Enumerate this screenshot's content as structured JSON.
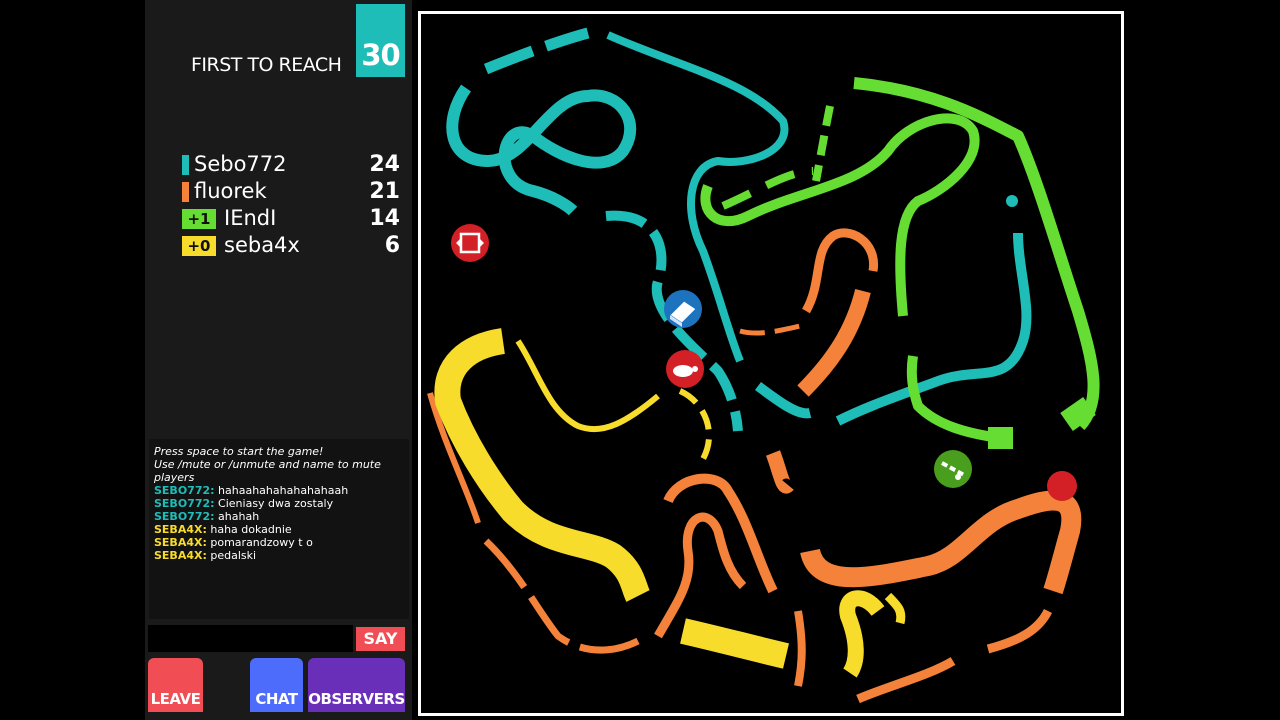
{
  "goal": {
    "label": "FIRST TO REACH",
    "value": "30"
  },
  "scoreboard": [
    {
      "name": "Sebo772",
      "score": "24",
      "color": "#1fbdb8",
      "badge": ""
    },
    {
      "name": "fluorek",
      "score": "21",
      "color": "#f5823a",
      "badge": ""
    },
    {
      "name": "IEndI",
      "score": "14",
      "color": "#66dd33",
      "badge": "+1"
    },
    {
      "name": "seba4x",
      "score": "6",
      "color": "#f8dc2c",
      "badge": "+0"
    }
  ],
  "chat": {
    "system_lines": [
      "Press space to start the game!",
      "Use /mute or /unmute and name to mute players"
    ],
    "messages": [
      {
        "user": "SEBO772:",
        "text": "hahaahahahahahahaah",
        "color": "#1fbdb8"
      },
      {
        "user": "SEBO772:",
        "text": "Cieniasy dwa zostaly",
        "color": "#1fbdb8"
      },
      {
        "user": "SEBO772:",
        "text": "ahahah",
        "color": "#1fbdb8"
      },
      {
        "user": "SEBA4X:",
        "text": "haha dokadnie",
        "color": "#f8dc2c"
      },
      {
        "user": "SEBA4X:",
        "text": "pomarandzowy t o",
        "color": "#f8dc2c"
      },
      {
        "user": "SEBA4X:",
        "text": "pedalski",
        "color": "#f8dc2c"
      }
    ],
    "input_value": "",
    "say_label": "SAY"
  },
  "buttons": {
    "leave": "LEAVE",
    "chat": "CHAT",
    "observers": "OBSERVERS"
  },
  "colors": {
    "teal": "#1fbdb8",
    "orange": "#f5823a",
    "green": "#66dd33",
    "yellow": "#f8dc2c",
    "arena_border": "#ffffff",
    "powerup_red": "#d32027",
    "powerup_blue": "#1e73be",
    "powerup_green": "#4a9e1e"
  },
  "powerups": [
    "reverse-controls-icon",
    "eraser-icon",
    "slow-turtle-icon",
    "self-fast-icon"
  ]
}
